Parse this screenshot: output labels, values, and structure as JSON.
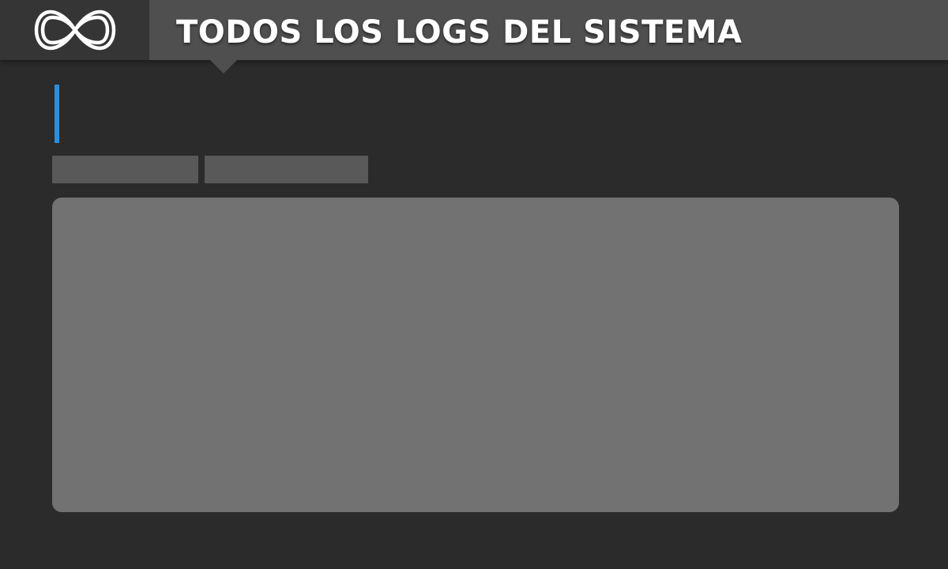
{
  "header": {
    "title": "TODOS LOS LOGS DEL SISTEMA",
    "logo_icon": "infinity-icon"
  },
  "colors": {
    "background": "#2b2b2b",
    "header_bar": "#4f4f4f",
    "logo_background": "#353535",
    "accent": "#2b8fe0",
    "tab": "#595959",
    "panel": "#727272"
  },
  "tabs": [
    {
      "label": ""
    },
    {
      "label": ""
    }
  ],
  "section": {
    "heading": ""
  }
}
